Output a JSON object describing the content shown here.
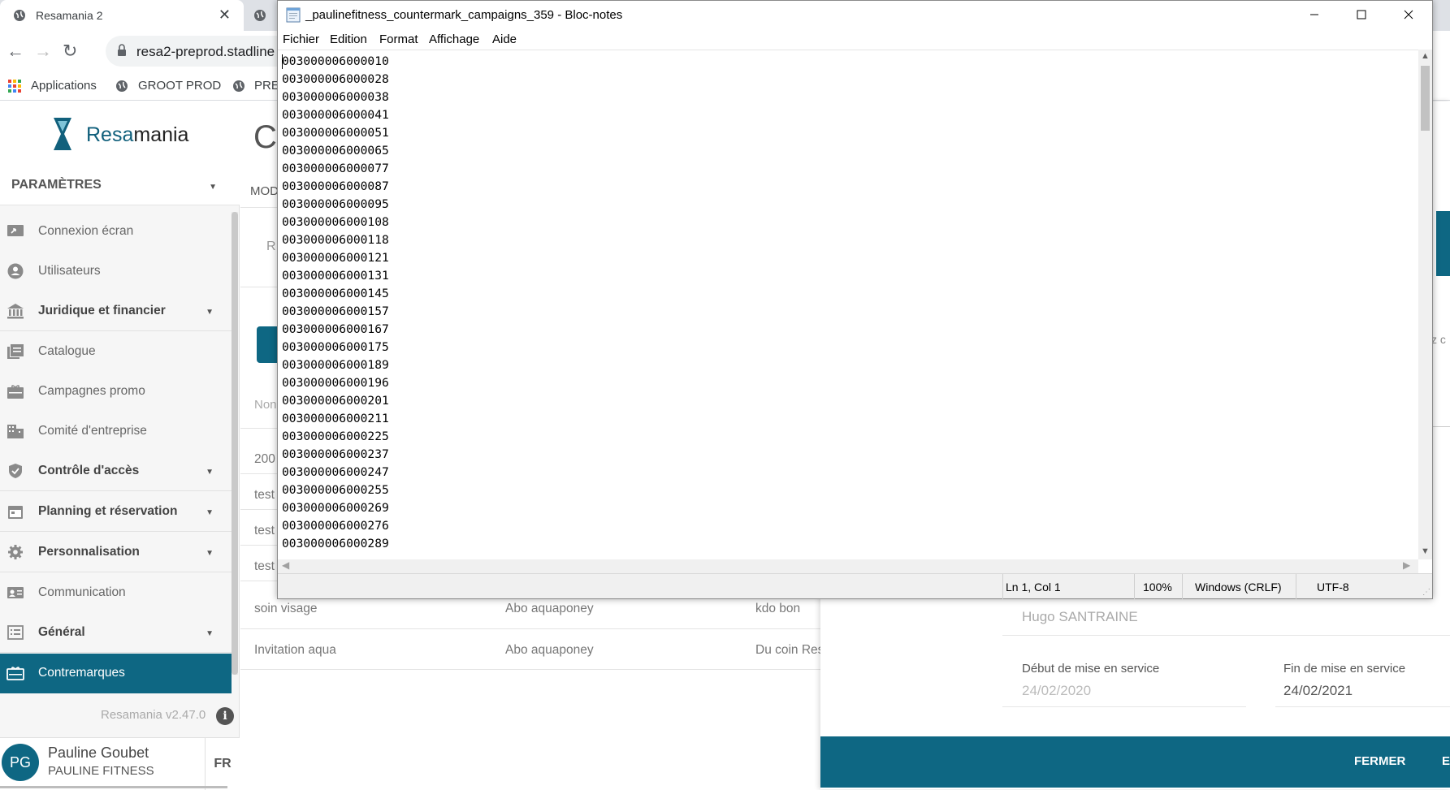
{
  "browser": {
    "tab_title": "Resamania 2",
    "url": "resa2-preprod.stadline",
    "bookmarks": [
      "Applications",
      "GROOT PROD",
      "PRE"
    ]
  },
  "app": {
    "logo_prefix": "Resa",
    "logo_suffix": "mania",
    "section": "PARAMÈTRES",
    "nav": [
      {
        "label": "Connexion écran",
        "bold": false
      },
      {
        "label": "Utilisateurs",
        "bold": false
      },
      {
        "label": "Juridique et financier",
        "bold": true
      },
      {
        "label": "Catalogue",
        "bold": false
      },
      {
        "label": "Campagnes promo",
        "bold": false
      },
      {
        "label": "Comité d'entreprise",
        "bold": false
      },
      {
        "label": "Contrôle d'accès",
        "bold": true
      },
      {
        "label": "Planning et réservation",
        "bold": true
      },
      {
        "label": "Personnalisation",
        "bold": true
      },
      {
        "label": "Communication",
        "bold": false
      },
      {
        "label": "Général",
        "bold": true
      },
      {
        "label": "Contremarques",
        "bold": false
      }
    ],
    "version": "Resamania v2.47.0",
    "user": {
      "initials": "PG",
      "name": "Pauline Goubet",
      "org": "PAULINE FITNESS",
      "lang": "FR"
    }
  },
  "main": {
    "heading_fragment": "C",
    "mode_fragment": "MOD",
    "field_fragment": "R",
    "column_fragment": "Non",
    "rows": [
      {
        "c1": "200",
        "c2": "",
        "c3": ""
      },
      {
        "c1": "test",
        "c2": "",
        "c3": ""
      },
      {
        "c1": "test",
        "c2": "",
        "c3": ""
      },
      {
        "c1": "test",
        "c2": "",
        "c3": ""
      },
      {
        "c1": "soin visage",
        "c2": "Abo aquaponey",
        "c3": "kdo bon"
      },
      {
        "c1": "Invitation aqua",
        "c2": "Abo aquaponey",
        "c3": "Du coin Res"
      }
    ]
  },
  "modal": {
    "side_fragment": "z c",
    "contact_value": "Hugo SANTRAINE",
    "start_label": "Début de mise en service",
    "start_value": "24/02/2020",
    "end_label": "Fin de mise en service",
    "end_value": "24/02/2021",
    "close_button": "FERMER",
    "second_button_fragment": "E"
  },
  "notepad": {
    "title": "_paulinefitness_countermark_campaigns_359 - Bloc-notes",
    "menu": [
      "Fichier",
      "Edition",
      "Format",
      "Affichage",
      "Aide"
    ],
    "lines": [
      "003000006000010",
      "003000006000028",
      "003000006000038",
      "003000006000041",
      "003000006000051",
      "003000006000065",
      "003000006000077",
      "003000006000087",
      "003000006000095",
      "003000006000108",
      "003000006000118",
      "003000006000121",
      "003000006000131",
      "003000006000145",
      "003000006000157",
      "003000006000167",
      "003000006000175",
      "003000006000189",
      "003000006000196",
      "003000006000201",
      "003000006000211",
      "003000006000225",
      "003000006000237",
      "003000006000247",
      "003000006000255",
      "003000006000269",
      "003000006000276",
      "003000006000289"
    ],
    "status": {
      "position": "Ln 1, Col 1",
      "zoom": "100%",
      "eol": "Windows (CRLF)",
      "encoding": "UTF-8"
    }
  },
  "colors": {
    "accent": "#0e6783",
    "sidebar_bg": "#f6f6f6"
  }
}
